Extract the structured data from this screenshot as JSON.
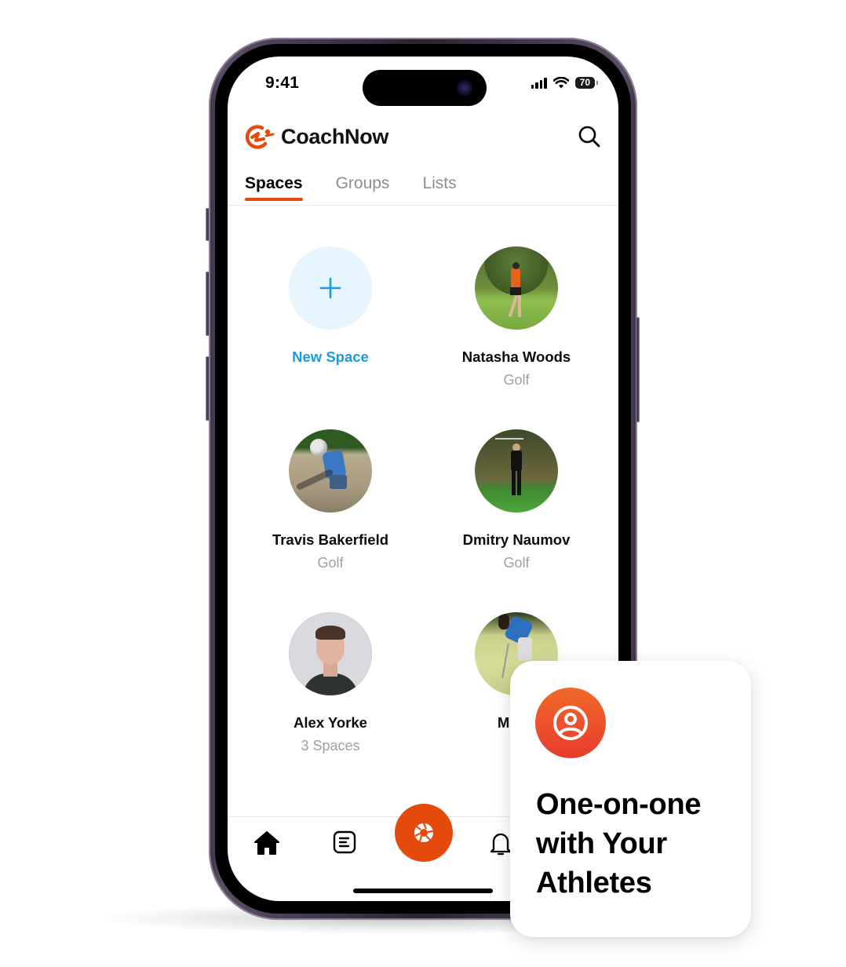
{
  "status_bar": {
    "time": "9:41",
    "battery": "70",
    "icons": [
      "signal-icon",
      "wifi-icon",
      "battery-icon"
    ]
  },
  "app": {
    "name": "CoachNow",
    "brand_color": "#e54a0d",
    "accent_blue": "#1a9be0",
    "search_icon": "search-icon"
  },
  "tabs": [
    {
      "label": "Spaces",
      "active": true
    },
    {
      "label": "Groups",
      "active": false
    },
    {
      "label": "Lists",
      "active": false
    }
  ],
  "spaces": [
    {
      "name": "New Space",
      "subtitle": "",
      "type": "new",
      "icon": "plus-icon"
    },
    {
      "name": "Natasha Woods",
      "subtitle": "Golf",
      "type": "athlete"
    },
    {
      "name": "Travis Bakerfield",
      "subtitle": "Golf",
      "type": "athlete"
    },
    {
      "name": "Dmitry Naumov",
      "subtitle": "Golf",
      "type": "athlete"
    },
    {
      "name": "Alex Yorke",
      "subtitle": "3 Spaces",
      "type": "athlete"
    },
    {
      "name": "Maria",
      "subtitle": "G",
      "type": "athlete"
    }
  ],
  "bottom_nav": {
    "items": [
      {
        "name": "home",
        "icon": "home-icon"
      },
      {
        "name": "feed",
        "icon": "list-icon"
      },
      {
        "name": "capture",
        "icon": "camera-shutter-icon"
      },
      {
        "name": "notifications",
        "icon": "bell-icon"
      }
    ]
  },
  "promo_card": {
    "icon": "user-circle-icon",
    "title": "One-on-one with Your Athletes"
  }
}
